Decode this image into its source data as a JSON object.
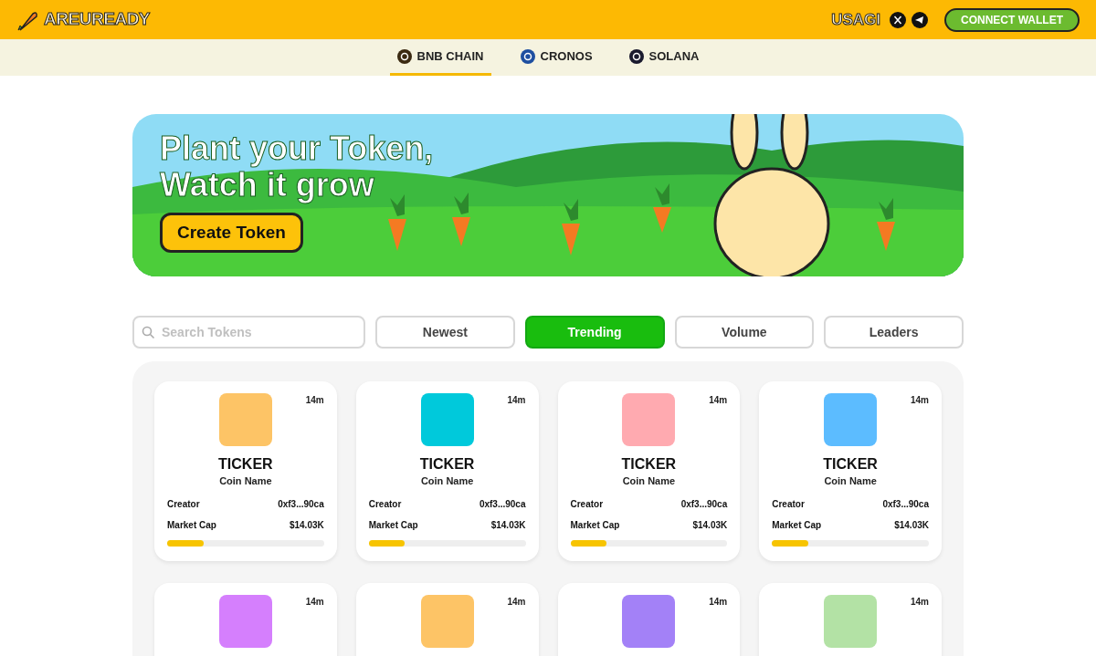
{
  "header": {
    "logo": "AREUREADY",
    "user": "USAGI",
    "connect_button": "CONNECT WALLET"
  },
  "chains": [
    {
      "label": "BNB CHAIN",
      "selected": true,
      "color": "#3b2a12"
    },
    {
      "label": "CRONOS",
      "selected": false,
      "color": "#1e4fa0"
    },
    {
      "label": "SOLANA",
      "selected": false,
      "color": "#1a1a2e"
    }
  ],
  "banner": {
    "title_line_1": "Plant your Token,",
    "title_line_2": "Watch it grow",
    "button": "Create Token"
  },
  "search": {
    "placeholder": "Search Tokens"
  },
  "filters": [
    {
      "label": "Newest",
      "selected": false
    },
    {
      "label": "Trending",
      "selected": true
    },
    {
      "label": "Volume",
      "selected": false
    },
    {
      "label": "Leaders",
      "selected": false
    }
  ],
  "cards": [
    {
      "color": "#fdc466",
      "time": "14m",
      "ticker": "TICKER",
      "name": "Coin Name",
      "creator_label": "Creator",
      "creator": "0xf3...90ca",
      "market_cap_label": "Market Cap",
      "market_cap": "$14.03K",
      "level": 0.23
    },
    {
      "color": "#00c9db",
      "time": "14m",
      "ticker": "TICKER",
      "name": "Coin Name",
      "creator_label": "Creator",
      "creator": "0xf3...90ca",
      "market_cap_label": "Market Cap",
      "market_cap": "$14.03K",
      "level": 0.23
    },
    {
      "color": "#ffaab0",
      "time": "14m",
      "ticker": "TICKER",
      "name": "Coin Name",
      "creator_label": "Creator",
      "creator": "0xf3...90ca",
      "market_cap_label": "Market Cap",
      "market_cap": "$14.03K",
      "level": 0.23
    },
    {
      "color": "#5cbcff",
      "time": "14m",
      "ticker": "TICKER",
      "name": "Coin Name",
      "creator_label": "Creator",
      "creator": "0xf3...90ca",
      "market_cap_label": "Market Cap",
      "market_cap": "$14.03K",
      "level": 0.23
    },
    {
      "color": "#d57ffd",
      "time": "14m"
    },
    {
      "color": "#fdc466",
      "time": "14m"
    },
    {
      "color": "#a381f7",
      "time": "14m"
    },
    {
      "color": "#b3e2a5",
      "time": "14m"
    }
  ]
}
